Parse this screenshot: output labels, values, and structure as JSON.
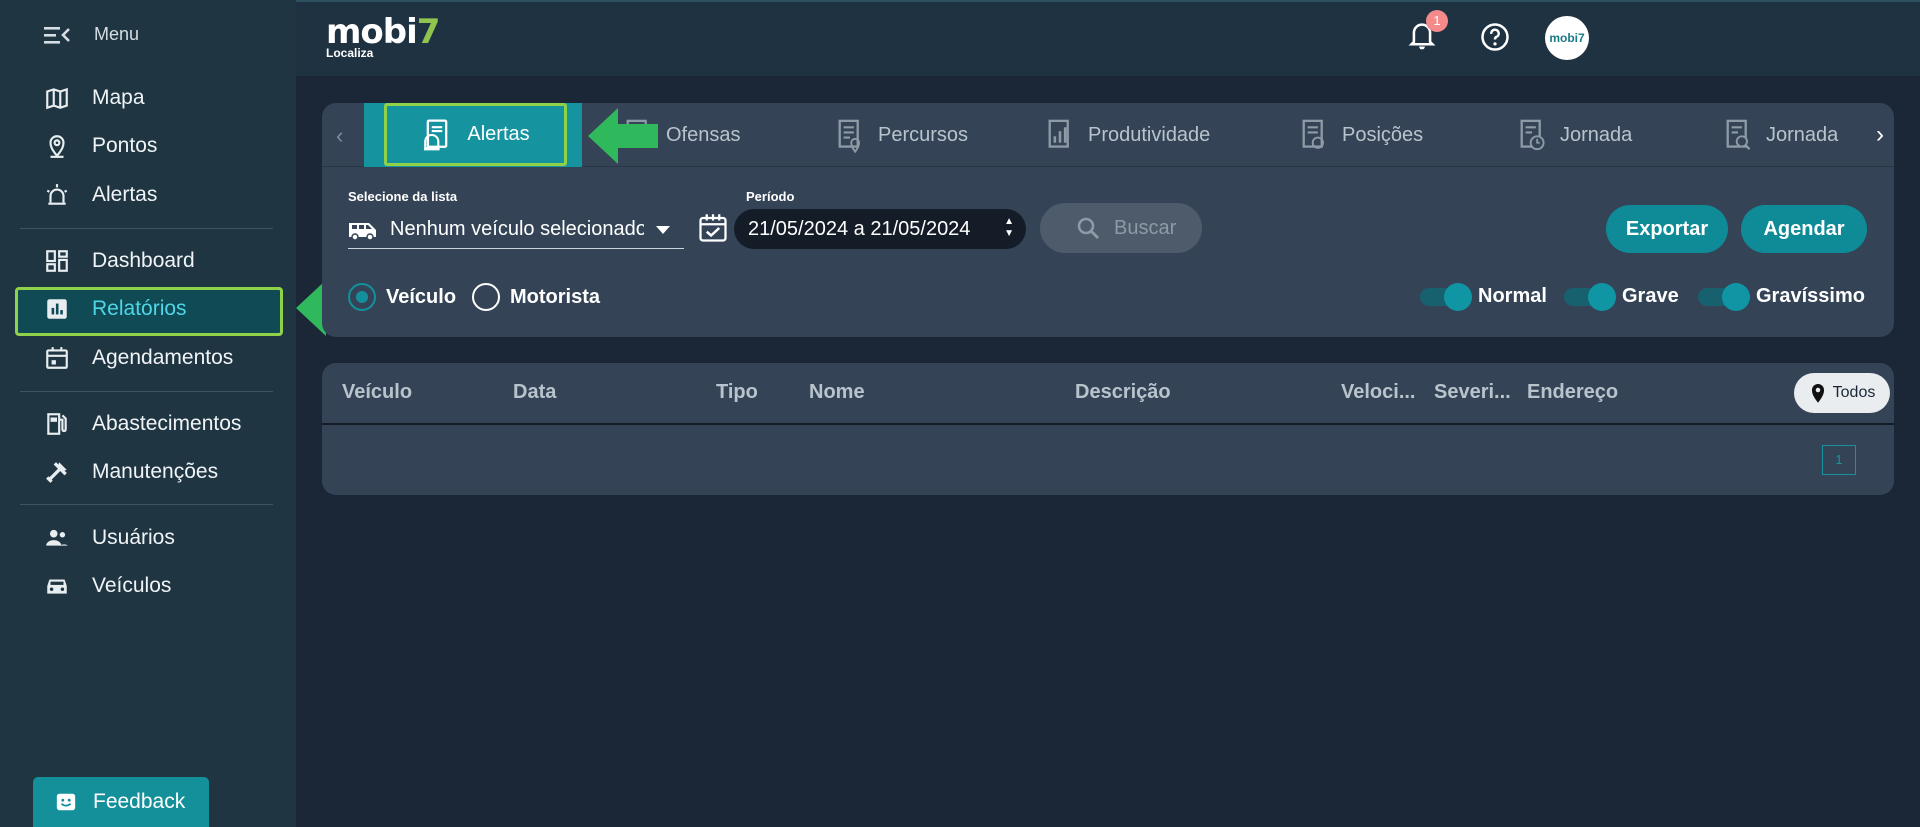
{
  "sidebar": {
    "menu_label": "Menu",
    "items": [
      {
        "label": "Mapa",
        "icon": "map-icon"
      },
      {
        "label": "Pontos",
        "icon": "location-pin-icon"
      },
      {
        "label": "Alertas",
        "icon": "alarm-light-icon"
      },
      {
        "label": "Dashboard",
        "icon": "dashboard-icon"
      },
      {
        "label": "Relatórios",
        "icon": "bar-chart-icon",
        "active": true
      },
      {
        "label": "Agendamentos",
        "icon": "calendar-icon"
      },
      {
        "label": "Abastecimentos",
        "icon": "fuel-pump-icon"
      },
      {
        "label": "Manutenções",
        "icon": "tools-icon"
      },
      {
        "label": "Usuários",
        "icon": "users-icon"
      },
      {
        "label": "Veículos",
        "icon": "car-icon"
      }
    ],
    "feedback_label": "Feedback"
  },
  "header": {
    "logo_text": "mobi",
    "logo_accent": "7",
    "logo_sub": "Localiza",
    "notification_count": "1",
    "avatar_text": "mobi7"
  },
  "tabs": [
    {
      "label": "Alertas",
      "icon": "alert-report-icon",
      "active": true
    },
    {
      "label": "Ofensas",
      "icon": "offense-report-icon"
    },
    {
      "label": "Percursos",
      "icon": "route-report-icon"
    },
    {
      "label": "Produtividade",
      "icon": "productivity-report-icon"
    },
    {
      "label": "Posições",
      "icon": "position-report-icon"
    },
    {
      "label": "Jornada",
      "icon": "journey-report-icon"
    },
    {
      "label": "Jornada",
      "icon": "journey-analysis-icon"
    }
  ],
  "filters": {
    "vehicle_label": "Selecione da lista",
    "vehicle_value": "Nenhum veículo selecionado",
    "period_label": "Período",
    "period_value": "21/05/2024 a 21/05/2024",
    "search_placeholder": "Buscar",
    "export_label": "Exportar",
    "schedule_label": "Agendar",
    "radio_vehicle": "Veículo",
    "radio_driver": "Motorista",
    "severity_normal": "Normal",
    "severity_grave": "Grave",
    "severity_gravissimo": "Gravíssimo"
  },
  "table": {
    "columns": [
      "Veículo",
      "Data",
      "Tipo",
      "Nome",
      "Descrição",
      "Veloci...",
      "Severi...",
      "Endereço"
    ],
    "todos_label": "Todos",
    "page": "1"
  },
  "colors": {
    "accent": "#0f8b98",
    "highlight": "#8fd24a",
    "arrow": "#2fb85c"
  }
}
